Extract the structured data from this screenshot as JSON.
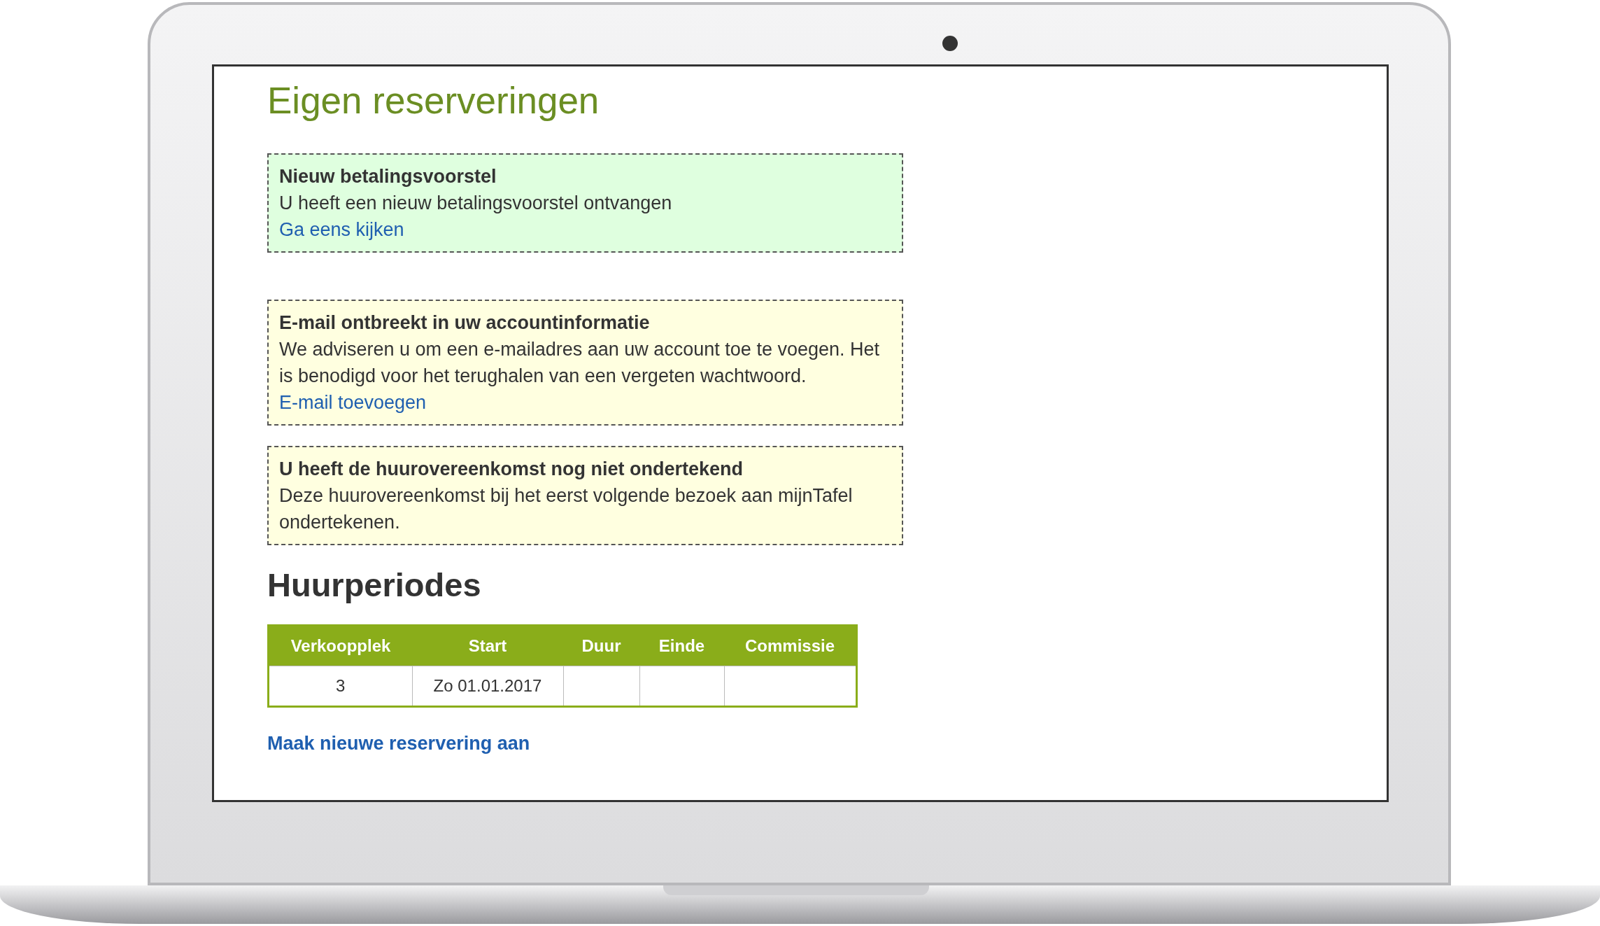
{
  "page": {
    "title": "Eigen reserveringen"
  },
  "notices": [
    {
      "kind": "success",
      "title": "Nieuw betalingsvoorstel",
      "text": "U heeft een nieuw betalingsvoorstel ontvangen",
      "link": "Ga eens kijken"
    },
    {
      "kind": "warning",
      "title": "E-mail ontbreekt in uw accountinformatie",
      "text": "We adviseren u om een e-mailadres aan uw account toe te voegen. Het is benodigd voor het terughalen van een vergeten wachtwoord.",
      "link": "E-mail toevoegen"
    },
    {
      "kind": "warning",
      "title": "U heeft de huurovereenkomst nog niet ondertekend",
      "text": "Deze huurovereenkomst bij het eerst volgende bezoek aan mijnTafel ondertekenen."
    }
  ],
  "section": {
    "heading": "Huurperiodes"
  },
  "table": {
    "columns": [
      "Verkoopplek",
      "Start",
      "Duur",
      "Einde",
      "Commissie"
    ],
    "rows": [
      {
        "cells": [
          "3",
          "Zo 01.01.2017"
        ]
      }
    ]
  },
  "action_link": "Maak nieuwe reservering aan"
}
